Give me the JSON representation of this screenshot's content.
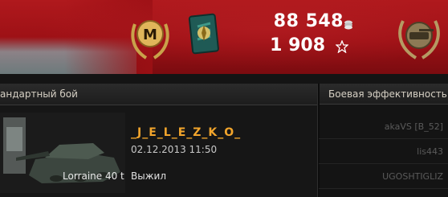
{
  "banner": {
    "credits": "88 548",
    "xp": "1 908",
    "mastery_letter": "M"
  },
  "headers": {
    "battle_type": "андартный бой",
    "efficiency": "Боевая эффективность"
  },
  "result": {
    "player": "_J_E_L_E_Z_K_O_",
    "date": "02.12.2013 11:50",
    "tank": "Lorraine 40 t",
    "status": "Выжил"
  },
  "efficiency_list": [
    {
      "name": "akaVS [B_52]"
    },
    {
      "name": "lis443"
    },
    {
      "name": "UGOSHTIGLIZ"
    }
  ],
  "colors": {
    "banner_red": "#9c1015",
    "player_gold": "#f2a52c"
  }
}
